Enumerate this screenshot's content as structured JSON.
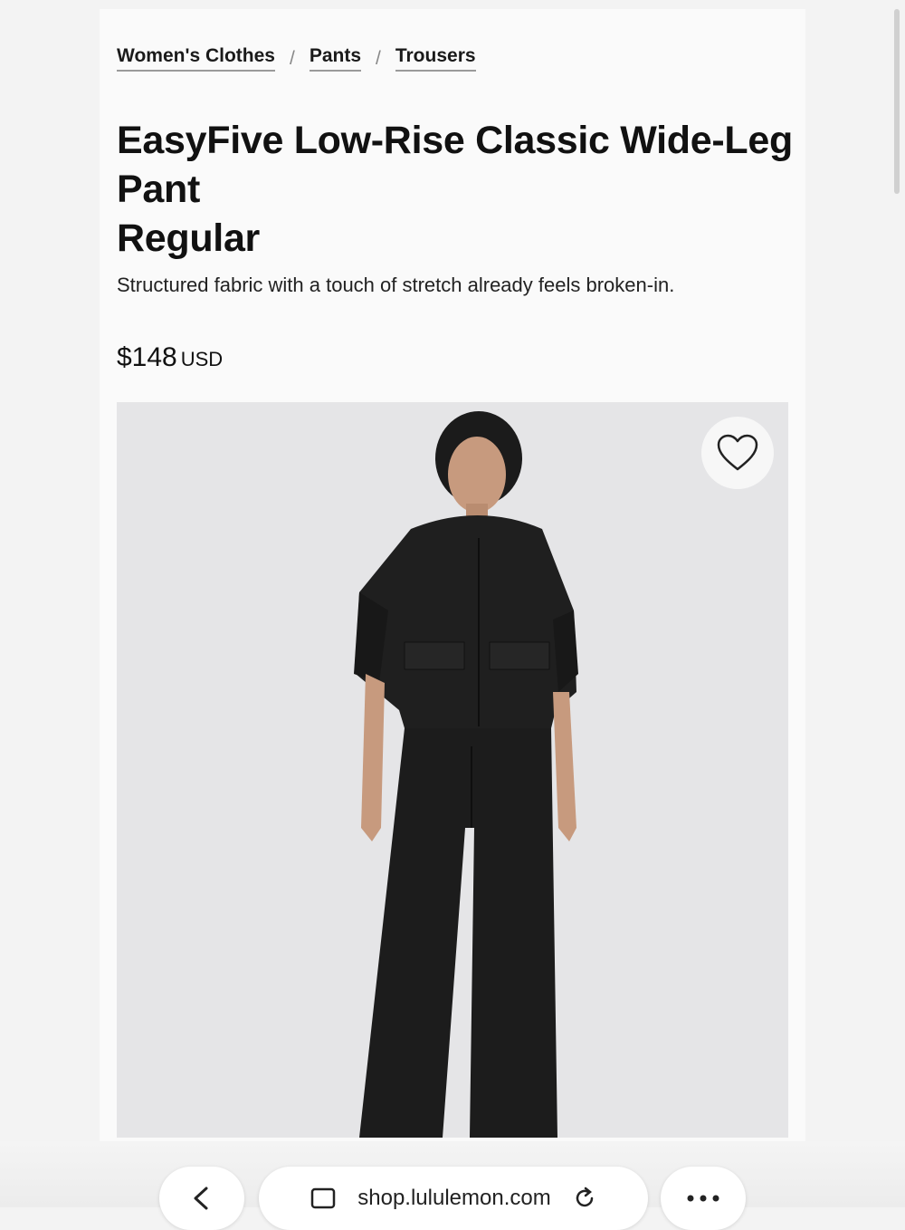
{
  "breadcrumb": {
    "items": [
      "Women's Clothes",
      "Pants",
      "Trousers"
    ],
    "separator": "/"
  },
  "product": {
    "title_line1": "EasyFive Low-Rise Classic Wide-Leg",
    "title_line2": "Pant",
    "title_line3": "Regular",
    "description": "Structured fabric with a touch of stretch already feels broken-in.",
    "price": "$148",
    "currency": "USD"
  },
  "browser": {
    "url": "shop.lululemon.com"
  }
}
